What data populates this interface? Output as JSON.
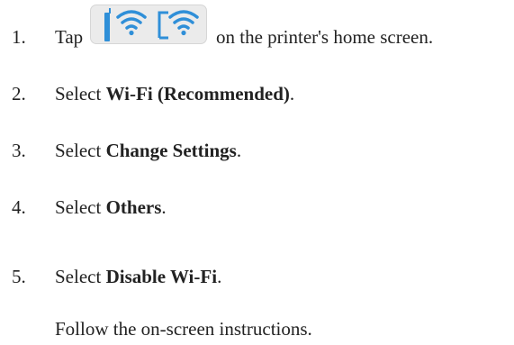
{
  "steps": [
    {
      "number": "1.",
      "before_icon": "Tap",
      "icon": "wifi-status-icons",
      "after_icon": "on the printer's home screen."
    },
    {
      "number": "2.",
      "prefix": "Select ",
      "bold": "Wi-Fi (Recommended)",
      "suffix": "."
    },
    {
      "number": "3.",
      "prefix": "Select ",
      "bold": "Change Settings",
      "suffix": "."
    },
    {
      "number": "4.",
      "prefix": "Select ",
      "bold": "Others",
      "suffix": "."
    },
    {
      "number": "5.",
      "prefix": "Select ",
      "bold": "Disable Wi-Fi",
      "suffix": "."
    }
  ],
  "note": "Follow the on-screen instructions.",
  "colors": {
    "text": "#222222",
    "icon_blue": "#2f8fd8",
    "icon_button_bg": "#ebebeb"
  }
}
